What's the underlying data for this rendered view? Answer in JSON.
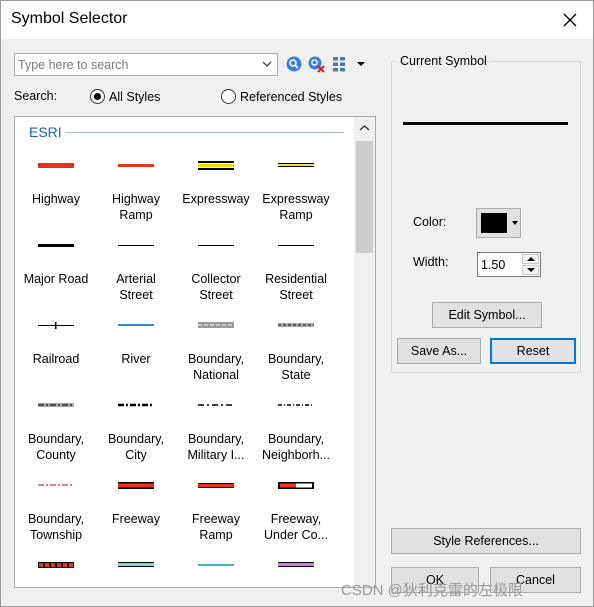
{
  "window": {
    "title": "Symbol Selector"
  },
  "search": {
    "placeholder": "Type here to search",
    "value": "",
    "label": "Search:"
  },
  "scope": {
    "options": [
      "All Styles",
      "Referenced Styles"
    ],
    "selected": "All Styles"
  },
  "gallery": {
    "group_title": "ESRI",
    "symbols": [
      {
        "label": "Highway",
        "style": "solid-red-thick"
      },
      {
        "label": "Highway\nRamp",
        "style": "solid-red"
      },
      {
        "label": "Expressway",
        "style": "cased-yellow"
      },
      {
        "label": "Expressway\nRamp",
        "style": "cased-yellow-thin"
      },
      {
        "label": "Major Road",
        "style": "solid-black-thick"
      },
      {
        "label": "Arterial\nStreet",
        "style": "solid-black-thin"
      },
      {
        "label": "Collector\nStreet",
        "style": "solid-black-thin"
      },
      {
        "label": "Residential\nStreet",
        "style": "solid-black-thin"
      },
      {
        "label": "Railroad",
        "style": "railroad"
      },
      {
        "label": "River",
        "style": "solid-blue"
      },
      {
        "label": "Boundary,\nNational",
        "style": "boundary-gray-dashed"
      },
      {
        "label": "Boundary,\nState",
        "style": "boundary-gray-dotted"
      },
      {
        "label": "Boundary,\nCounty",
        "style": "boundary-gray-dashdot"
      },
      {
        "label": "Boundary,\nCity",
        "style": "dash-dot-black"
      },
      {
        "label": "Boundary,\nMilitary I...",
        "style": "dash-dot-black-thin"
      },
      {
        "label": "Boundary,\nNeighborh...",
        "style": "dotted-black"
      },
      {
        "label": "Boundary,\nTownship",
        "style": "dashdot-red"
      },
      {
        "label": "Freeway",
        "style": "cased-red"
      },
      {
        "label": "Freeway\nRamp",
        "style": "cased-red-thin"
      },
      {
        "label": "Freeway,\nUnder Co...",
        "style": "cased-red-white"
      },
      {
        "label": "",
        "style": "dashed-red-box"
      },
      {
        "label": "",
        "style": "cased-cyan"
      },
      {
        "label": "",
        "style": "solid-cyan"
      },
      {
        "label": "",
        "style": "cased-purple"
      }
    ]
  },
  "current_symbol": {
    "group_label": "Current Symbol",
    "color_label": "Color:",
    "color_value": "#000000",
    "width_label": "Width:",
    "width_value": "1.50",
    "edit_button": "Edit Symbol...",
    "save_as_button": "Save As...",
    "reset_button": "Reset"
  },
  "footer": {
    "style_references_button": "Style References...",
    "ok_button": "OK",
    "cancel_button": "Cancel"
  },
  "watermark": "CSDN @狄利克雷的左极限",
  "colors": {
    "esri_blue": "#1e5fbf",
    "focus_border": "#0078d7",
    "highway_red": "#e8331c",
    "river_blue": "#2e8fd8"
  }
}
